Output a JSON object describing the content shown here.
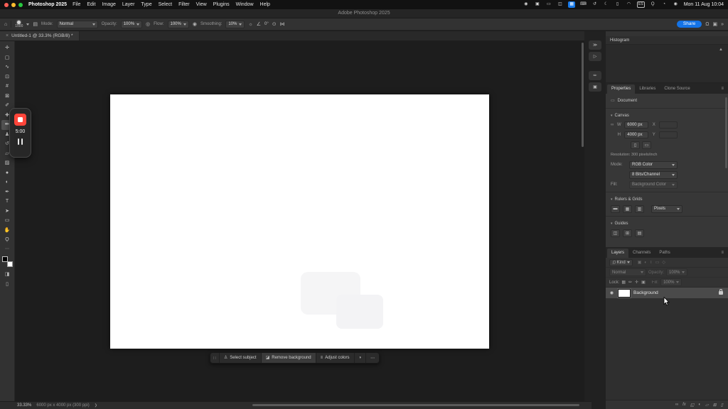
{
  "menubar": {
    "window_controls": [
      {
        "name": "close-window-button",
        "color": "#ff5f57"
      },
      {
        "name": "minimize-window-button",
        "color": "#febc2e"
      },
      {
        "name": "zoom-window-button",
        "color": "#28c840"
      }
    ],
    "app_name": "Photoshop 2025",
    "menus": [
      "File",
      "Edit",
      "Image",
      "Layer",
      "Type",
      "Select",
      "Filter",
      "View",
      "Plugins",
      "Window",
      "Help"
    ],
    "status_icons": [
      {
        "name": "record-dot-icon",
        "glyph": "◉"
      },
      {
        "name": "camera-status-icon",
        "glyph": "▣"
      },
      {
        "name": "display-status-icon",
        "glyph": "▭"
      },
      {
        "name": "stage-manager-icon",
        "glyph": "◫"
      },
      {
        "name": "screen-mirroring-icon",
        "glyph": "▦",
        "active": true
      },
      {
        "name": "keyboard-status-icon",
        "glyph": "⌨"
      },
      {
        "name": "time-machine-icon",
        "glyph": "↺"
      },
      {
        "name": "do-not-disturb-icon",
        "glyph": "☾"
      },
      {
        "name": "battery-icon",
        "glyph": "▯"
      },
      {
        "name": "wifi-icon",
        "glyph": "◠"
      },
      {
        "name": "input-source-badge",
        "glyph": "ES",
        "badge": true
      },
      {
        "name": "spotlight-icon",
        "glyph": "Ϙ"
      },
      {
        "name": "control-center-icon",
        "glyph": "◔"
      },
      {
        "name": "siri-icon",
        "glyph": "◉"
      }
    ],
    "clock": "Mon 11 Aug 10:04"
  },
  "titlebar": {
    "title": "Adobe Photoshop 2025"
  },
  "options_bar": {
    "home_icon": "⌂",
    "brush_dot_icon": "●",
    "brush_size": "1500",
    "toggle_brush_panel_icon": "▤",
    "mode_label": "Mode:",
    "mode_value": "Normal",
    "opacity_label": "Opacity:",
    "opacity_value": "100%",
    "pressure_icon": "◎",
    "flow_label": "Flow:",
    "flow_value": "100%",
    "airbrush_icon": "◉",
    "smoothing_label": "Smoothing:",
    "smoothing_value": "10%",
    "gear_icon": "☼",
    "angle_icon": "∠",
    "angle_value": "0°",
    "pressure_size_icon": "⊙",
    "symmetry_icon": "⋈",
    "share_button": "Share",
    "bell_icon": "Ω",
    "workspace_icon": "▣",
    "chevron_icon": "»"
  },
  "document_tab": {
    "close_icon": "×",
    "title": "Untitled-1 @ 33.3% (RGB/8) *"
  },
  "toolbar": {
    "tools": [
      {
        "name": "move-tool",
        "glyph": "✛"
      },
      {
        "name": "rectangular-marquee-tool",
        "glyph": "▢"
      },
      {
        "name": "lasso-tool",
        "glyph": "∿"
      },
      {
        "name": "object-selection-tool",
        "glyph": "⊡"
      },
      {
        "name": "crop-tool",
        "glyph": "#"
      },
      {
        "name": "frame-tool",
        "glyph": "⊠"
      },
      {
        "name": "eyedropper-tool",
        "glyph": "✐"
      },
      {
        "name": "healing-brush-tool",
        "glyph": "✚"
      },
      {
        "name": "brush-tool",
        "glyph": "✏",
        "active": true
      },
      {
        "name": "clone-stamp-tool",
        "glyph": "♟"
      },
      {
        "name": "history-brush-tool",
        "glyph": "↺"
      },
      {
        "name": "eraser-tool",
        "glyph": "▱"
      },
      {
        "name": "gradient-tool",
        "glyph": "▨"
      },
      {
        "name": "blur-tool",
        "glyph": "●"
      },
      {
        "name": "dodge-tool",
        "glyph": "◐"
      },
      {
        "name": "pen-tool",
        "glyph": "✒"
      },
      {
        "name": "type-tool",
        "glyph": "T"
      },
      {
        "name": "path-selection-tool",
        "glyph": "➤"
      },
      {
        "name": "rectangle-tool",
        "glyph": "▭"
      },
      {
        "name": "hand-tool",
        "glyph": "✋"
      },
      {
        "name": "zoom-tool",
        "glyph": "Ϙ"
      }
    ],
    "more_icon": "⋯",
    "foreground_color": "#000000",
    "background_color": "#ffffff",
    "quick_mask_icon": "◨",
    "screen_mode_icon": "▯"
  },
  "recorder": {
    "time": "5:00"
  },
  "task_bar": {
    "grip_icon": "∷",
    "buttons": [
      {
        "name": "select-subject-button",
        "icon": "♙",
        "label": "Select subject"
      },
      {
        "name": "remove-background-button",
        "icon": "◪",
        "label": "Remove background",
        "highlight": true
      },
      {
        "name": "adjust-colors-button",
        "icon": "≡",
        "label": "Adjust colors"
      }
    ],
    "color_icon": "◑",
    "more_icon": "⋯"
  },
  "panel_strip": {
    "icons_top": [
      {
        "name": "expand-panels-icon",
        "glyph": "≫"
      },
      {
        "name": "history-panel-icon",
        "glyph": "▷"
      }
    ],
    "icons_bottom": [
      {
        "name": "brushes-panel-icon",
        "glyph": "✏"
      },
      {
        "name": "clone-source-panel-icon",
        "glyph": "▣"
      }
    ]
  },
  "right_panel": {
    "histogram": {
      "title": "Histogram",
      "warning_icon": "▲"
    },
    "properties": {
      "tabs": [
        {
          "name": "tab-properties",
          "label": "Properties",
          "active": true
        },
        {
          "name": "tab-libraries",
          "label": "Libraries"
        },
        {
          "name": "tab-clone-source",
          "label": "Clone Source"
        }
      ],
      "menu_icon": "≡",
      "document_icon": "▭",
      "document_label": "Document",
      "chevron_icon": "▾",
      "canvas_section_label": "Canvas",
      "link_icon": "∞",
      "w_label": "W",
      "w_value": "6000 px",
      "x_label": "X",
      "h_label": "H",
      "h_value": "4000 px",
      "y_label": "Y",
      "portrait_icon": "▯",
      "landscape_icon": "▭",
      "resolution_text": "Resolution: 300 pixels/inch",
      "mode_label": "Mode:",
      "mode_value": "RGB Color",
      "depth_value": "8 Bits/Channel",
      "fill_label": "Fill:",
      "fill_value": "Background Color",
      "rulers_section_label": "Rulers & Grids",
      "ruler_icon": "▬",
      "grid_icon": "▦",
      "snap_icon": "▥",
      "units_value": "Pixels",
      "guides_section_label": "Guides",
      "guide_icons": [
        {
          "name": "new-guide-layout-icon",
          "glyph": "◫"
        },
        {
          "name": "lock-guides-icon",
          "glyph": "⊞"
        },
        {
          "name": "clear-guides-icon",
          "glyph": "▤"
        }
      ]
    },
    "layers": {
      "tabs": [
        {
          "name": "tab-layers",
          "label": "Layers",
          "active": true
        },
        {
          "name": "tab-channels",
          "label": "Channels"
        },
        {
          "name": "tab-paths",
          "label": "Paths"
        }
      ],
      "menu_icon": "≡",
      "search_icon": "Ϙ",
      "filter_value": "Kind",
      "filter_icons": [
        {
          "name": "filter-pixel-layers-icon",
          "glyph": "▣"
        },
        {
          "name": "filter-adjustment-layers-icon",
          "glyph": "◐"
        },
        {
          "name": "filter-type-layers-icon",
          "glyph": "T"
        },
        {
          "name": "filter-shape-layers-icon",
          "glyph": "▭"
        },
        {
          "name": "filter-smart-objects-icon",
          "glyph": "◇"
        }
      ],
      "blend_mode_value": "Normal",
      "opacity_label": "Opacity:",
      "opacity_value": "100%",
      "lock_label": "Lock:",
      "lock_icons": [
        {
          "name": "lock-transparency-icon",
          "glyph": "▦"
        },
        {
          "name": "lock-pixels-icon",
          "glyph": "✏"
        },
        {
          "name": "lock-position-icon",
          "glyph": "✛"
        },
        {
          "name": "lock-all-icon",
          "glyph": "▣"
        }
      ],
      "fill_label": "Fill:",
      "fill_value": "100%",
      "eye_icon": "◉",
      "rows": [
        {
          "name": "Background",
          "selected": true
        }
      ],
      "footer_icons": [
        {
          "name": "link-layers-icon",
          "glyph": "∞"
        },
        {
          "name": "layer-effects-icon",
          "glyph": "fx"
        },
        {
          "name": "add-layer-mask-icon",
          "glyph": "◱"
        },
        {
          "name": "adjustment-layer-icon",
          "glyph": "◐"
        },
        {
          "name": "new-group-icon",
          "glyph": "▱"
        },
        {
          "name": "new-layer-icon",
          "glyph": "⊞"
        },
        {
          "name": "delete-layer-icon",
          "glyph": "▯"
        }
      ]
    }
  },
  "status_bar": {
    "zoom": "33.33%",
    "doc_info": "6000 px x 4000 px (300 ppi)",
    "chevron_icon": "❯"
  }
}
